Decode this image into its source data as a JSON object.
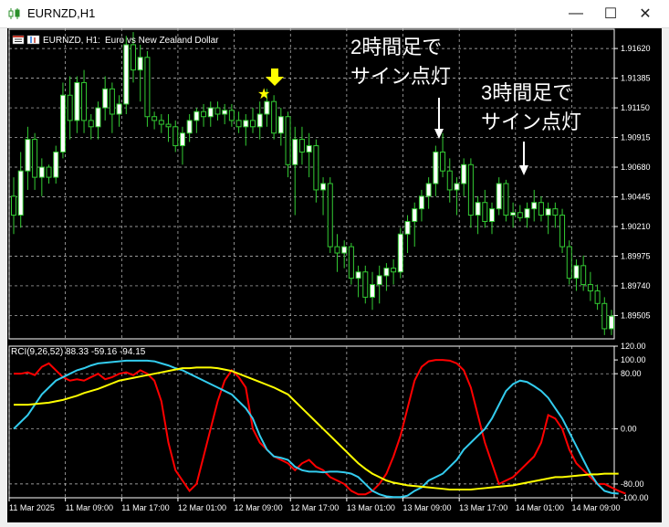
{
  "window": {
    "title": "EURNZD,H1",
    "minimize_glyph": "—",
    "maximize_glyph": "☐",
    "close_glyph": "✕",
    "icon": "candlestick-chart-icon"
  },
  "colors": {
    "background": "#000000",
    "grid": "#c8c8c8",
    "axis_text": "#ffffff",
    "bull_candle": "#ffffff",
    "bear_candle": "#000000",
    "candle_outline": "#33cc33",
    "rci_fast": "#ff0000",
    "rci_mid": "#33ccee",
    "rci_slow": "#ffff00",
    "arrow": "#ffff00",
    "annotation": "#ffffff"
  },
  "chart_info": {
    "symbol_label": "EURNZD, H1:",
    "description": "Euro vs New Zealand Dollar"
  },
  "indicator": {
    "label": "RCI(9,26,52) 88.33 -59.16 -94.15"
  },
  "annotations": {
    "note1_line1": "2時間足で",
    "note1_line2": "サイン点灯",
    "note2_line1": "3時間足で",
    "note2_line2": "サイン点灯",
    "star_glyph": "★",
    "arrow_glyph": "🡇"
  },
  "chart_data": [
    {
      "type": "candlestick",
      "title": "EURNZD, H1: Euro vs New Zealand Dollar",
      "ylim": [
        1.8932,
        1.9178
      ],
      "yticks": [
        1.9162,
        1.91385,
        1.9115,
        1.90915,
        1.9068,
        1.90445,
        1.9021,
        1.89975,
        1.8974,
        1.89505
      ],
      "ytick_labels": [
        "1.91620",
        "1.91385",
        "1.91150",
        "1.90915",
        "1.90680",
        "1.90445",
        "1.90210",
        "1.89975",
        "1.89740",
        "1.89505"
      ],
      "x_labels": [
        "11 Mar 2025",
        "11 Mar 09:00",
        "11 Mar 17:00",
        "12 Mar 01:00",
        "12 Mar 09:00",
        "12 Mar 17:00",
        "13 Mar 01:00",
        "13 Mar 09:00",
        "13 Mar 17:00",
        "14 Mar 01:00",
        "14 Mar 09:00"
      ],
      "x_label_bars": [
        0,
        8,
        16,
        24,
        32,
        40,
        48,
        56,
        64,
        72,
        80
      ],
      "bars": [
        {
          "o": 1.9045,
          "h": 1.906,
          "l": 1.9015,
          "c": 1.903
        },
        {
          "o": 1.903,
          "h": 1.908,
          "l": 1.902,
          "c": 1.9065
        },
        {
          "o": 1.9065,
          "h": 1.91,
          "l": 1.905,
          "c": 1.909
        },
        {
          "o": 1.909,
          "h": 1.9095,
          "l": 1.905,
          "c": 1.906
        },
        {
          "o": 1.906,
          "h": 1.9075,
          "l": 1.9045,
          "c": 1.9068
        },
        {
          "o": 1.9068,
          "h": 1.907,
          "l": 1.9055,
          "c": 1.906
        },
        {
          "o": 1.906,
          "h": 1.9085,
          "l": 1.9055,
          "c": 1.908
        },
        {
          "o": 1.908,
          "h": 1.9135,
          "l": 1.9075,
          "c": 1.9125
        },
        {
          "o": 1.9125,
          "h": 1.914,
          "l": 1.909,
          "c": 1.9105
        },
        {
          "o": 1.9105,
          "h": 1.914,
          "l": 1.9095,
          "c": 1.9135
        },
        {
          "o": 1.9135,
          "h": 1.9145,
          "l": 1.9095,
          "c": 1.9105
        },
        {
          "o": 1.9105,
          "h": 1.911,
          "l": 1.909,
          "c": 1.91
        },
        {
          "o": 1.91,
          "h": 1.912,
          "l": 1.909,
          "c": 1.9115
        },
        {
          "o": 1.9115,
          "h": 1.914,
          "l": 1.9105,
          "c": 1.913
        },
        {
          "o": 1.913,
          "h": 1.9135,
          "l": 1.9095,
          "c": 1.911
        },
        {
          "o": 1.911,
          "h": 1.9125,
          "l": 1.91,
          "c": 1.9118
        },
        {
          "o": 1.9118,
          "h": 1.9172,
          "l": 1.911,
          "c": 1.9165
        },
        {
          "o": 1.9165,
          "h": 1.9175,
          "l": 1.9135,
          "c": 1.9145
        },
        {
          "o": 1.9145,
          "h": 1.9165,
          "l": 1.912,
          "c": 1.9155
        },
        {
          "o": 1.9155,
          "h": 1.916,
          "l": 1.91,
          "c": 1.9108
        },
        {
          "o": 1.9108,
          "h": 1.9112,
          "l": 1.9098,
          "c": 1.9105
        },
        {
          "o": 1.9105,
          "h": 1.911,
          "l": 1.9095,
          "c": 1.9102
        },
        {
          "o": 1.9102,
          "h": 1.911,
          "l": 1.9088,
          "c": 1.91
        },
        {
          "o": 1.91,
          "h": 1.9105,
          "l": 1.908,
          "c": 1.9085
        },
        {
          "o": 1.9085,
          "h": 1.91,
          "l": 1.907,
          "c": 1.9095
        },
        {
          "o": 1.9095,
          "h": 1.911,
          "l": 1.9088,
          "c": 1.9105
        },
        {
          "o": 1.9105,
          "h": 1.9115,
          "l": 1.9095,
          "c": 1.9112
        },
        {
          "o": 1.9112,
          "h": 1.9118,
          "l": 1.91,
          "c": 1.9108
        },
        {
          "o": 1.9108,
          "h": 1.912,
          "l": 1.91,
          "c": 1.9115
        },
        {
          "o": 1.9115,
          "h": 1.912,
          "l": 1.9105,
          "c": 1.911
        },
        {
          "o": 1.911,
          "h": 1.9118,
          "l": 1.9102,
          "c": 1.9113
        },
        {
          "o": 1.9113,
          "h": 1.9118,
          "l": 1.91,
          "c": 1.9105
        },
        {
          "o": 1.9105,
          "h": 1.9112,
          "l": 1.9095,
          "c": 1.91
        },
        {
          "o": 1.91,
          "h": 1.911,
          "l": 1.9085,
          "c": 1.9105
        },
        {
          "o": 1.9105,
          "h": 1.9115,
          "l": 1.9095,
          "c": 1.91
        },
        {
          "o": 1.91,
          "h": 1.912,
          "l": 1.909,
          "c": 1.911
        },
        {
          "o": 1.911,
          "h": 1.913,
          "l": 1.91,
          "c": 1.912
        },
        {
          "o": 1.912,
          "h": 1.9125,
          "l": 1.909,
          "c": 1.9095
        },
        {
          "o": 1.9095,
          "h": 1.9115,
          "l": 1.9085,
          "c": 1.9108
        },
        {
          "o": 1.9108,
          "h": 1.9112,
          "l": 1.906,
          "c": 1.907
        },
        {
          "o": 1.907,
          "h": 1.91,
          "l": 1.903,
          "c": 1.909
        },
        {
          "o": 1.909,
          "h": 1.91,
          "l": 1.907,
          "c": 1.908
        },
        {
          "o": 1.908,
          "h": 1.9095,
          "l": 1.906,
          "c": 1.9085
        },
        {
          "o": 1.9085,
          "h": 1.909,
          "l": 1.904,
          "c": 1.905
        },
        {
          "o": 1.905,
          "h": 1.906,
          "l": 1.903,
          "c": 1.9055
        },
        {
          "o": 1.9055,
          "h": 1.906,
          "l": 1.9,
          "c": 1.9005
        },
        {
          "o": 1.9005,
          "h": 1.9015,
          "l": 1.8985,
          "c": 1.9
        },
        {
          "o": 1.9,
          "h": 1.901,
          "l": 1.8988,
          "c": 1.9005
        },
        {
          "o": 1.9005,
          "h": 1.9008,
          "l": 1.8975,
          "c": 1.898
        },
        {
          "o": 1.898,
          "h": 1.899,
          "l": 1.8965,
          "c": 1.8985
        },
        {
          "o": 1.8985,
          "h": 1.899,
          "l": 1.896,
          "c": 1.8965
        },
        {
          "o": 1.8965,
          "h": 1.8985,
          "l": 1.8955,
          "c": 1.8975
        },
        {
          "o": 1.8975,
          "h": 1.899,
          "l": 1.896,
          "c": 1.8982
        },
        {
          "o": 1.8982,
          "h": 1.8992,
          "l": 1.897,
          "c": 1.8988
        },
        {
          "o": 1.8988,
          "h": 1.8995,
          "l": 1.8975,
          "c": 1.8985
        },
        {
          "o": 1.8985,
          "h": 1.902,
          "l": 1.898,
          "c": 1.9015
        },
        {
          "o": 1.9015,
          "h": 1.903,
          "l": 1.9,
          "c": 1.9025
        },
        {
          "o": 1.9025,
          "h": 1.904,
          "l": 1.9005,
          "c": 1.9035
        },
        {
          "o": 1.9035,
          "h": 1.905,
          "l": 1.9025,
          "c": 1.9045
        },
        {
          "o": 1.9045,
          "h": 1.906,
          "l": 1.9035,
          "c": 1.9055
        },
        {
          "o": 1.9055,
          "h": 1.9085,
          "l": 1.9045,
          "c": 1.908
        },
        {
          "o": 1.908,
          "h": 1.9095,
          "l": 1.906,
          "c": 1.9065
        },
        {
          "o": 1.9065,
          "h": 1.9075,
          "l": 1.904,
          "c": 1.905
        },
        {
          "o": 1.905,
          "h": 1.906,
          "l": 1.903,
          "c": 1.9055
        },
        {
          "o": 1.9055,
          "h": 1.9075,
          "l": 1.9045,
          "c": 1.907
        },
        {
          "o": 1.907,
          "h": 1.9075,
          "l": 1.902,
          "c": 1.903
        },
        {
          "o": 1.903,
          "h": 1.9045,
          "l": 1.9015,
          "c": 1.904
        },
        {
          "o": 1.904,
          "h": 1.905,
          "l": 1.902,
          "c": 1.9025
        },
        {
          "o": 1.9025,
          "h": 1.904,
          "l": 1.9015,
          "c": 1.9035
        },
        {
          "o": 1.9035,
          "h": 1.906,
          "l": 1.903,
          "c": 1.9055
        },
        {
          "o": 1.9055,
          "h": 1.9058,
          "l": 1.9025,
          "c": 1.903
        },
        {
          "o": 1.903,
          "h": 1.904,
          "l": 1.902,
          "c": 1.9032
        },
        {
          "o": 1.9032,
          "h": 1.9038,
          "l": 1.9025,
          "c": 1.9028
        },
        {
          "o": 1.9028,
          "h": 1.904,
          "l": 1.902,
          "c": 1.9035
        },
        {
          "o": 1.9035,
          "h": 1.905,
          "l": 1.9025,
          "c": 1.904
        },
        {
          "o": 1.904,
          "h": 1.9045,
          "l": 1.9025,
          "c": 1.903
        },
        {
          "o": 1.903,
          "h": 1.904,
          "l": 1.9015,
          "c": 1.9035
        },
        {
          "o": 1.9035,
          "h": 1.904,
          "l": 1.902,
          "c": 1.903
        },
        {
          "o": 1.903,
          "h": 1.9035,
          "l": 1.9,
          "c": 1.9005
        },
        {
          "o": 1.9005,
          "h": 1.901,
          "l": 1.8975,
          "c": 1.898
        },
        {
          "o": 1.898,
          "h": 1.8995,
          "l": 1.897,
          "c": 1.899
        },
        {
          "o": 1.899,
          "h": 1.8998,
          "l": 1.897,
          "c": 1.8975
        },
        {
          "o": 1.8975,
          "h": 1.8985,
          "l": 1.8962,
          "c": 1.897
        },
        {
          "o": 1.897,
          "h": 1.8975,
          "l": 1.8955,
          "c": 1.896
        },
        {
          "o": 1.896,
          "h": 1.8965,
          "l": 1.8935,
          "c": 1.894
        },
        {
          "o": 1.894,
          "h": 1.8955,
          "l": 1.8935,
          "c": 1.895
        }
      ]
    },
    {
      "type": "line",
      "title": "RCI(9,26,52) 88.33 -59.16 -94.15",
      "ylim": [
        -100,
        120
      ],
      "yticks": [
        120,
        100,
        80,
        0,
        -80,
        -100
      ],
      "ytick_labels": [
        "120.00",
        "100.00",
        "80.00",
        "0.00",
        "-80.00",
        "-100.00"
      ],
      "series": [
        {
          "color": "#ff0000",
          "values": [
            80,
            80,
            82,
            78,
            90,
            95,
            85,
            75,
            70,
            72,
            70,
            75,
            80,
            72,
            75,
            80,
            82,
            78,
            85,
            80,
            70,
            40,
            -20,
            -60,
            -75,
            -90,
            -80,
            -40,
            0,
            40,
            70,
            85,
            75,
            60,
            0,
            -20,
            -30,
            -40,
            -45,
            -50,
            -60,
            -50,
            -45,
            -55,
            -60,
            -70,
            -75,
            -80,
            -90,
            -95,
            -95,
            -90,
            -80,
            -65,
            -40,
            -10,
            30,
            70,
            90,
            98,
            100,
            100,
            99,
            95,
            85,
            60,
            20,
            -20,
            -50,
            -80,
            -75,
            -70,
            -60,
            -50,
            -40,
            -20,
            20,
            15,
            0,
            -30,
            -50,
            -60,
            -70,
            -80,
            -80,
            -85,
            -90,
            -94
          ]
        },
        {
          "color": "#33ccee",
          "values": [
            0,
            10,
            20,
            35,
            50,
            60,
            70,
            75,
            80,
            85,
            88,
            92,
            95,
            96,
            97,
            98,
            99,
            99,
            99,
            99,
            98,
            95,
            92,
            88,
            85,
            80,
            75,
            70,
            65,
            60,
            55,
            50,
            40,
            30,
            15,
            -10,
            -30,
            -40,
            -42,
            -45,
            -55,
            -60,
            -62,
            -62,
            -63,
            -62,
            -62,
            -63,
            -65,
            -70,
            -80,
            -90,
            -95,
            -98,
            -99,
            -99,
            -97,
            -90,
            -85,
            -75,
            -70,
            -65,
            -55,
            -45,
            -30,
            -20,
            -10,
            0,
            15,
            35,
            55,
            65,
            70,
            68,
            62,
            55,
            45,
            30,
            15,
            -5,
            -25,
            -45,
            -65,
            -80,
            -90,
            -93,
            -94
          ]
        },
        {
          "color": "#ffff00",
          "values": [
            35,
            35,
            35,
            36,
            37,
            38,
            40,
            42,
            45,
            48,
            52,
            55,
            58,
            62,
            66,
            70,
            72,
            74,
            76,
            78,
            80,
            82,
            84,
            86,
            88,
            88,
            89,
            89,
            89,
            88,
            86,
            84,
            80,
            76,
            72,
            68,
            64,
            60,
            55,
            50,
            40,
            30,
            20,
            10,
            0,
            -10,
            -20,
            -30,
            -40,
            -50,
            -58,
            -65,
            -70,
            -75,
            -78,
            -80,
            -82,
            -83,
            -84,
            -85,
            -86,
            -87,
            -88,
            -88,
            -88,
            -88,
            -87,
            -86,
            -85,
            -84,
            -83,
            -82,
            -80,
            -78,
            -76,
            -74,
            -72,
            -70,
            -70,
            -69,
            -68,
            -67,
            -66,
            -66,
            -65,
            -65,
            -65
          ]
        }
      ]
    }
  ]
}
